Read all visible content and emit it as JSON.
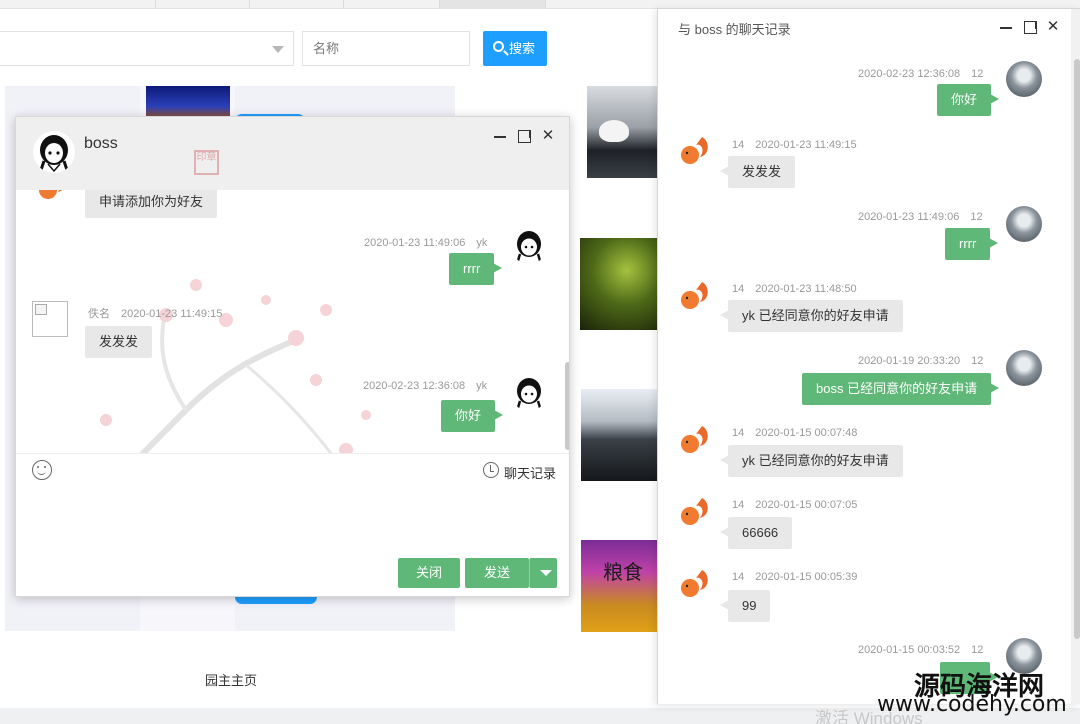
{
  "background": {
    "select_placeholder": "",
    "name_input_placeholder": "名称",
    "search_button": "搜索",
    "footer_link": "园主主页",
    "food_thumb_text": "粮食"
  },
  "chat": {
    "contact_name": "boss",
    "seal_text": "印章",
    "history_link": "聊天记录",
    "close_button": "关闭",
    "send_button": "发送",
    "messages": [
      {
        "side": "left",
        "meta": "",
        "text": "申请添加你为好友"
      },
      {
        "side": "right",
        "meta": "2020-01-23 11:49:06　yk",
        "text": "rrrr"
      },
      {
        "side": "left",
        "meta": "佚名　2020-01-23 11:49:15",
        "text": "发发发"
      },
      {
        "side": "right",
        "meta": "2020-02-23 12:36:08　yk",
        "text": "你好"
      }
    ]
  },
  "history": {
    "title": "与 boss 的聊天记录",
    "messages": [
      {
        "side": "right",
        "meta": "2020-02-23 12:36:08　12",
        "text": "你好"
      },
      {
        "side": "left",
        "meta": "14　2020-01-23 11:49:15",
        "text": "发发发"
      },
      {
        "side": "right",
        "meta": "2020-01-23 11:49:06　12",
        "text": "rrrr"
      },
      {
        "side": "left",
        "meta": "14　2020-01-23 11:48:50",
        "text": "yk 已经同意你的好友申请"
      },
      {
        "side": "right",
        "meta": "2020-01-19 20:33:20　12",
        "text": "boss 已经同意你的好友申请"
      },
      {
        "side": "left",
        "meta": "14　2020-01-15 00:07:48",
        "text": "yk 已经同意你的好友申请"
      },
      {
        "side": "left",
        "meta": "14　2020-01-15 00:07:05",
        "text": "66666"
      },
      {
        "side": "left",
        "meta": "14　2020-01-15 00:05:39",
        "text": "99"
      },
      {
        "side": "right",
        "meta": "2020-01-15 00:03:52　12",
        "text": ""
      }
    ]
  },
  "watermark": {
    "site_name": "源码海洋网",
    "site_url": "www.codehy.com",
    "activate_windows": "激活 Windows"
  },
  "colors": {
    "accent_blue": "#1e9fff",
    "accent_green": "#5fb878",
    "bubble_gray": "#e8e8e8"
  }
}
